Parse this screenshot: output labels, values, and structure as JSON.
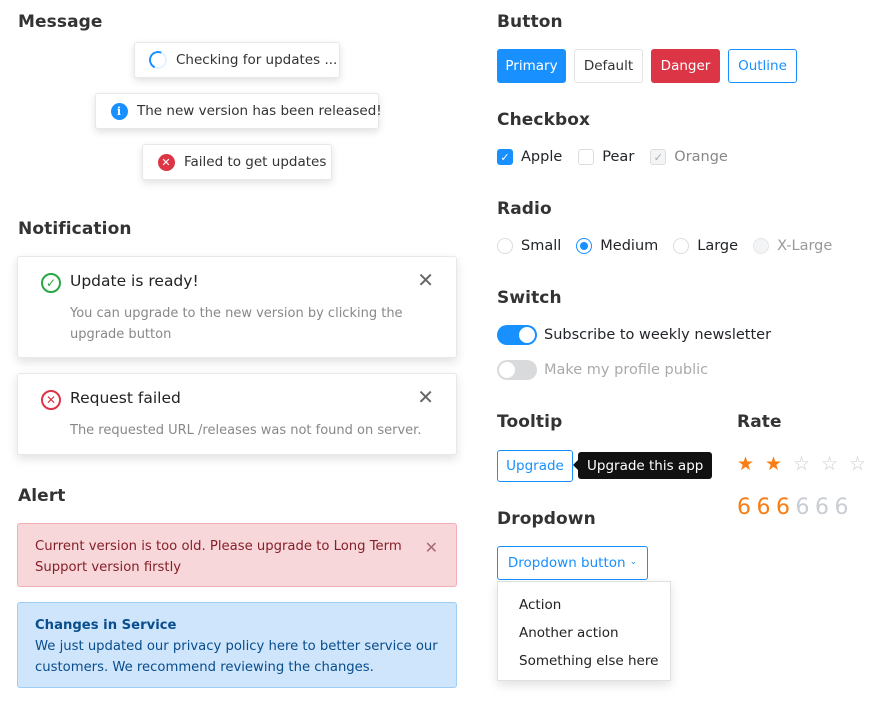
{
  "message": {
    "title": "Message",
    "items": [
      {
        "type": "loading",
        "icon": "spinner-icon",
        "text": "Checking for updates ..."
      },
      {
        "type": "info",
        "icon": "info-icon",
        "icon_glyph": "i",
        "text": "The new version has been released!"
      },
      {
        "type": "error",
        "icon": "error-icon",
        "icon_glyph": "✕",
        "text": "Failed to get updates"
      }
    ]
  },
  "notification": {
    "title": "Notification",
    "items": [
      {
        "type": "success",
        "icon": "check-circle-icon",
        "icon_glyph": "✓",
        "title": "Update is ready!",
        "description": "You can upgrade to the new version by clicking the upgrade button",
        "close_glyph": "✕"
      },
      {
        "type": "error",
        "icon": "error-circle-icon",
        "icon_glyph": "✕",
        "title": "Request failed",
        "description": "The requested URL /releases was not found on server.",
        "close_glyph": "✕"
      }
    ]
  },
  "alert": {
    "title": "Alert",
    "danger": {
      "text": "Current version is too old. Please upgrade to Long Term Support version firstly",
      "close_glyph": "✕"
    },
    "info": {
      "title": "Changes in Service",
      "text": "We just updated our privacy policy here to better service our customers. We recommend reviewing the changes."
    }
  },
  "button": {
    "title": "Button",
    "items": [
      "Primary",
      "Default",
      "Danger",
      "Outline"
    ]
  },
  "checkbox": {
    "title": "Checkbox",
    "items": [
      {
        "label": "Apple",
        "checked": true,
        "disabled": false
      },
      {
        "label": "Pear",
        "checked": false,
        "disabled": false
      },
      {
        "label": "Orange",
        "checked": true,
        "disabled": true
      }
    ],
    "check_glyph": "✓"
  },
  "radio": {
    "title": "Radio",
    "items": [
      {
        "label": "Small",
        "checked": false,
        "disabled": false
      },
      {
        "label": "Medium",
        "checked": true,
        "disabled": false
      },
      {
        "label": "Large",
        "checked": false,
        "disabled": false
      },
      {
        "label": "X-Large",
        "checked": false,
        "disabled": true
      }
    ]
  },
  "switch": {
    "title": "Switch",
    "items": [
      {
        "label": "Subscribe to weekly newsletter",
        "on": true,
        "disabled": false
      },
      {
        "label": "Make my profile public",
        "on": false,
        "disabled": true
      }
    ]
  },
  "tooltip": {
    "title": "Tooltip",
    "button_label": "Upgrade",
    "tooltip_text": "Upgrade this app"
  },
  "rate": {
    "title": "Rate",
    "stars": {
      "value": 2,
      "max": 5,
      "full_glyph": "★",
      "empty_glyph": "☆"
    },
    "digits": {
      "value": 3,
      "max": 6,
      "glyph": "6"
    },
    "active_color": "#fa7d14",
    "inactive_color": "#c9cdd4"
  },
  "dropdown": {
    "title": "Dropdown",
    "button_label": "Dropdown button",
    "chevron_glyph": "⌄",
    "items": [
      "Action",
      "Another action",
      "Something else here"
    ]
  },
  "colors": {
    "primary": "#1890ff",
    "danger": "#dc3545",
    "success": "#28a745"
  }
}
